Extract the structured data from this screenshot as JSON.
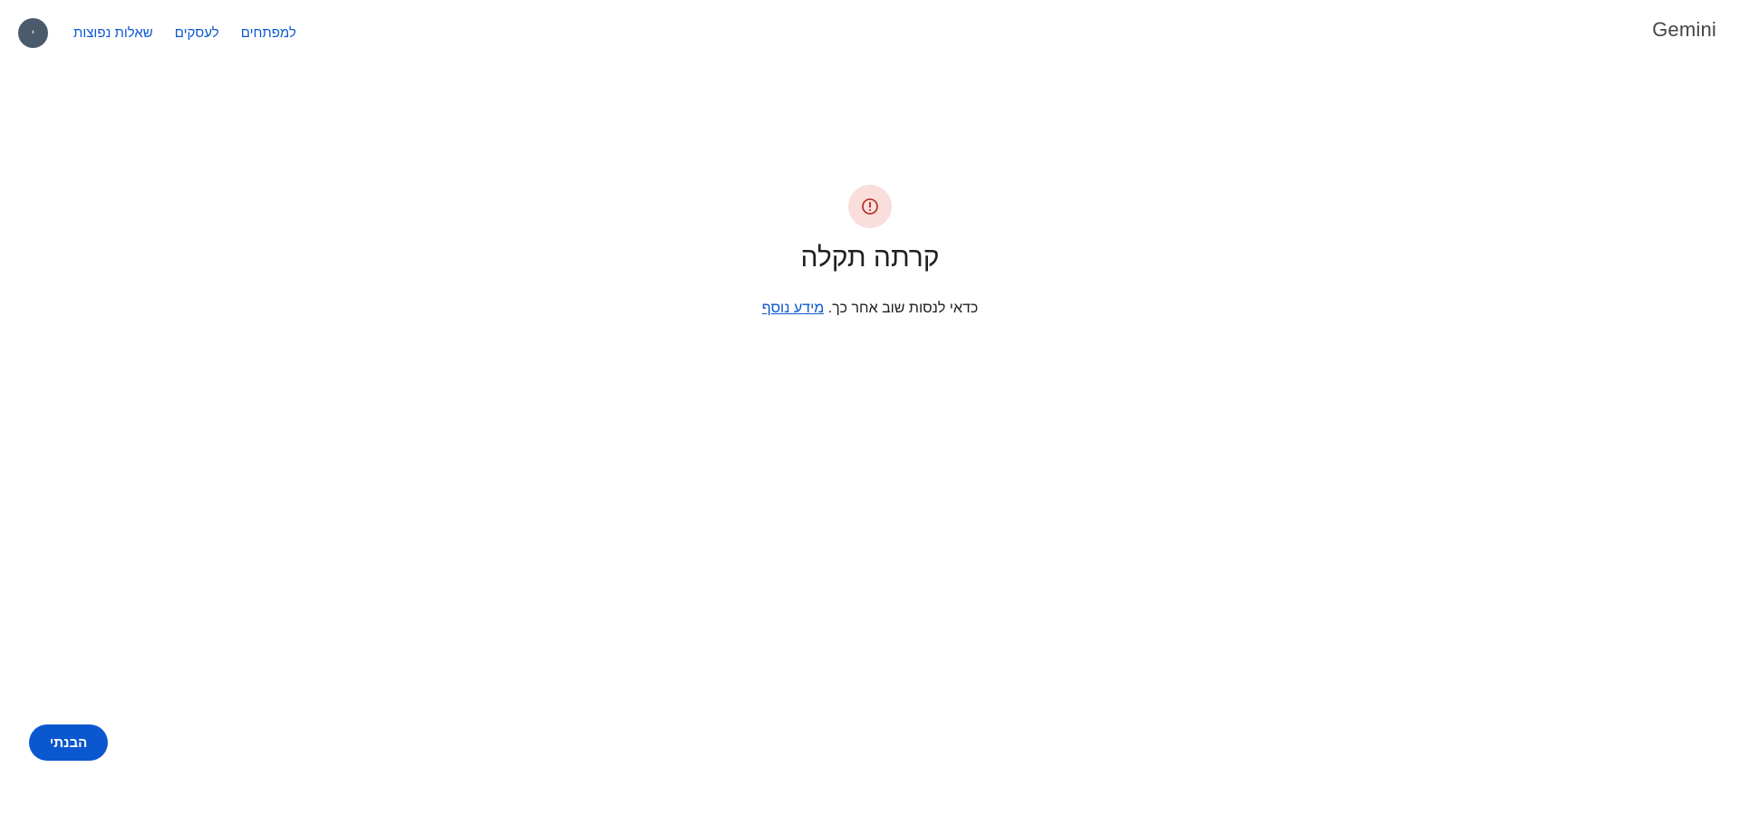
{
  "header": {
    "brand": "Gemini",
    "nav_links": [
      {
        "label": "למפתחים"
      },
      {
        "label": "לעסקים"
      },
      {
        "label": "שאלות נפוצות"
      }
    ],
    "avatar_initial": "י"
  },
  "error": {
    "icon": "error-circle-icon",
    "title": "קרתה תקלה",
    "message": "כדאי לנסות שוב אחר כך.",
    "learn_more": "מידע נוסף"
  },
  "actions": {
    "dismiss_label": "הבנתי"
  },
  "colors": {
    "accent": "#0b57d0",
    "error_icon": "#b3261e",
    "error_icon_bg": "#f9dedc",
    "avatar_bg": "#4a5b6c"
  }
}
